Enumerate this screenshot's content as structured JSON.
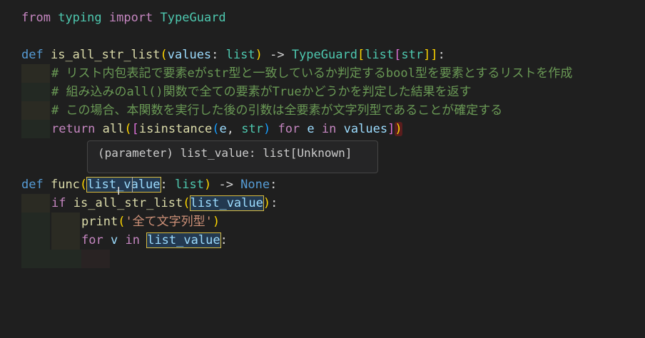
{
  "code": {
    "l1": {
      "kw1": "from",
      "mod": "typing",
      "kw2": "import",
      "name": "TypeGuard"
    },
    "l3": {
      "def": "def",
      "fname": "is_all_str_list",
      "open": "(",
      "param": "values",
      "colon": ": ",
      "ptype": "list",
      "close": ")",
      "arrow": " -> ",
      "rtype": "TypeGuard",
      "b1": "[",
      "t1": "list",
      "b2": "[",
      "t2": "str",
      "b3": "]]",
      ":": ":"
    },
    "l4": "# リスト内包表記で要素eがstr型と一致しているか判定するbool型を要素とするリストを作成",
    "l5": "# 組み込みのall()関数で全ての要素がTrueかどうかを判定した結果を返す",
    "l6": "# この場合、本関数を実行した後の引数は全要素が文字列型であることが確定する",
    "l7": {
      "ret": "return",
      "all": "all",
      "p1": "(",
      "b1": "[",
      "isinst": "isinstance",
      "p2": "(",
      "e": "e",
      "comma": ", ",
      "str": "str",
      "p2c": ")",
      "for": "for",
      "e2": "e",
      "in": "in",
      "vals": "values",
      "b1c": "]",
      "p1c": ")"
    },
    "l9": {
      "def": "def",
      "fname": "func",
      "open": "(",
      "param": "list_value",
      "colon": ": ",
      "ptype": "list",
      "close": ")",
      "arrow": " -> ",
      "none": "None",
      ":": ":"
    },
    "l10": {
      "if": "if",
      "call": "is_all_str_list",
      "open": "(",
      "arg": "list_value",
      "close": ")",
      ":": ":"
    },
    "l11": {
      "print": "print",
      "open": "(",
      "s": "'全て文字列型'",
      "close": ")"
    },
    "l12": {
      "for": "for",
      "v": "v",
      "in": "in",
      "var": "list_value",
      ":": ":"
    }
  },
  "tooltip": "(parameter) list_value: list[Unknown]",
  "icons": {
    "cursor": "text-cursor-icon"
  }
}
